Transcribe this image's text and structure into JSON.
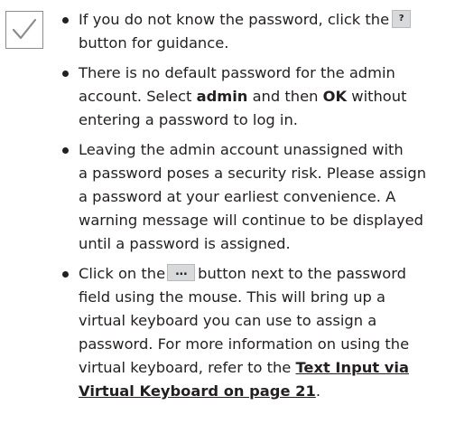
{
  "icons": {
    "note": "checkmark-icon",
    "help_button": "?",
    "ellipsis_button": "..."
  },
  "bullets": [
    {
      "l1_pre": "If you do not know the password, click the",
      "l2": "button for guidance."
    },
    {
      "l1": "There is no default password for the admin",
      "l2_pre": "account. Select ",
      "l2_b1": "admin",
      "l2_mid": " and then ",
      "l2_b2": "OK",
      "l2_post": " without",
      "l3": "entering a password to log in."
    },
    {
      "l1": "Leaving the admin account unassigned with",
      "l2": "a password poses a security risk. Please assign",
      "l3": "a password at your earliest convenience. A",
      "l4": "warning message will continue to be displayed",
      "l5": "until a password is assigned."
    },
    {
      "l1_pre": "Click on the",
      "l1_post": "button next to the password",
      "l2": "field using the mouse. This will bring up a",
      "l3": "virtual keyboard you can use to assign a",
      "l4": "password. For more information on using the",
      "l5": "virtual keyboard, refer to the ",
      "link_1": "Text Input via ",
      "link_2": "Virtual Keyboard on page 21",
      "l6_post": "."
    }
  ]
}
